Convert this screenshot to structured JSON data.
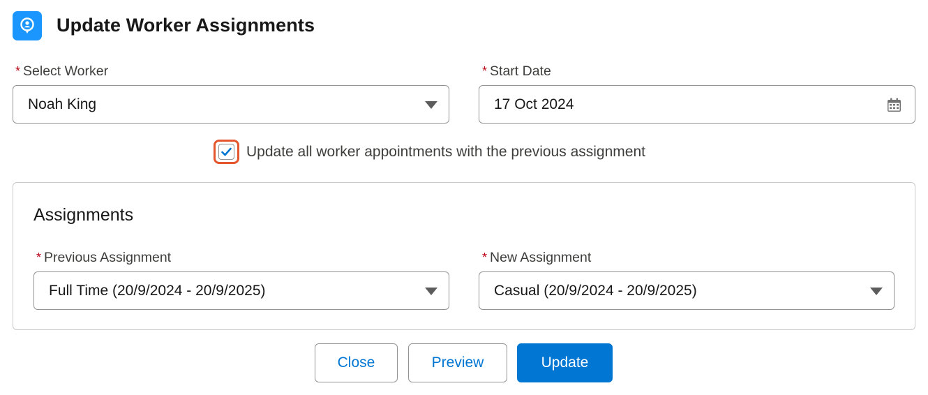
{
  "header": {
    "title": "Update Worker Assignments",
    "icon": "worker-assignment-icon",
    "icon_color": "#1b96ff"
  },
  "fields": {
    "required_marker": "*",
    "worker": {
      "label": "Select Worker",
      "value": "Noah King"
    },
    "start_date": {
      "label": "Start Date",
      "value": "17 Oct 2024"
    }
  },
  "checkbox": {
    "label": "Update all worker appointments with the previous assignment",
    "checked": true,
    "focus_color": "#e4572e"
  },
  "assignments": {
    "title": "Assignments",
    "previous": {
      "label": "Previous Assignment",
      "value": "Full Time (20/9/2024 - 20/9/2025)"
    },
    "new": {
      "label": "New Assignment",
      "value": "Casual (20/9/2024 - 20/9/2025)"
    }
  },
  "footer": {
    "close_label": "Close",
    "preview_label": "Preview",
    "update_label": "Update",
    "brand_color": "#0176d3"
  }
}
